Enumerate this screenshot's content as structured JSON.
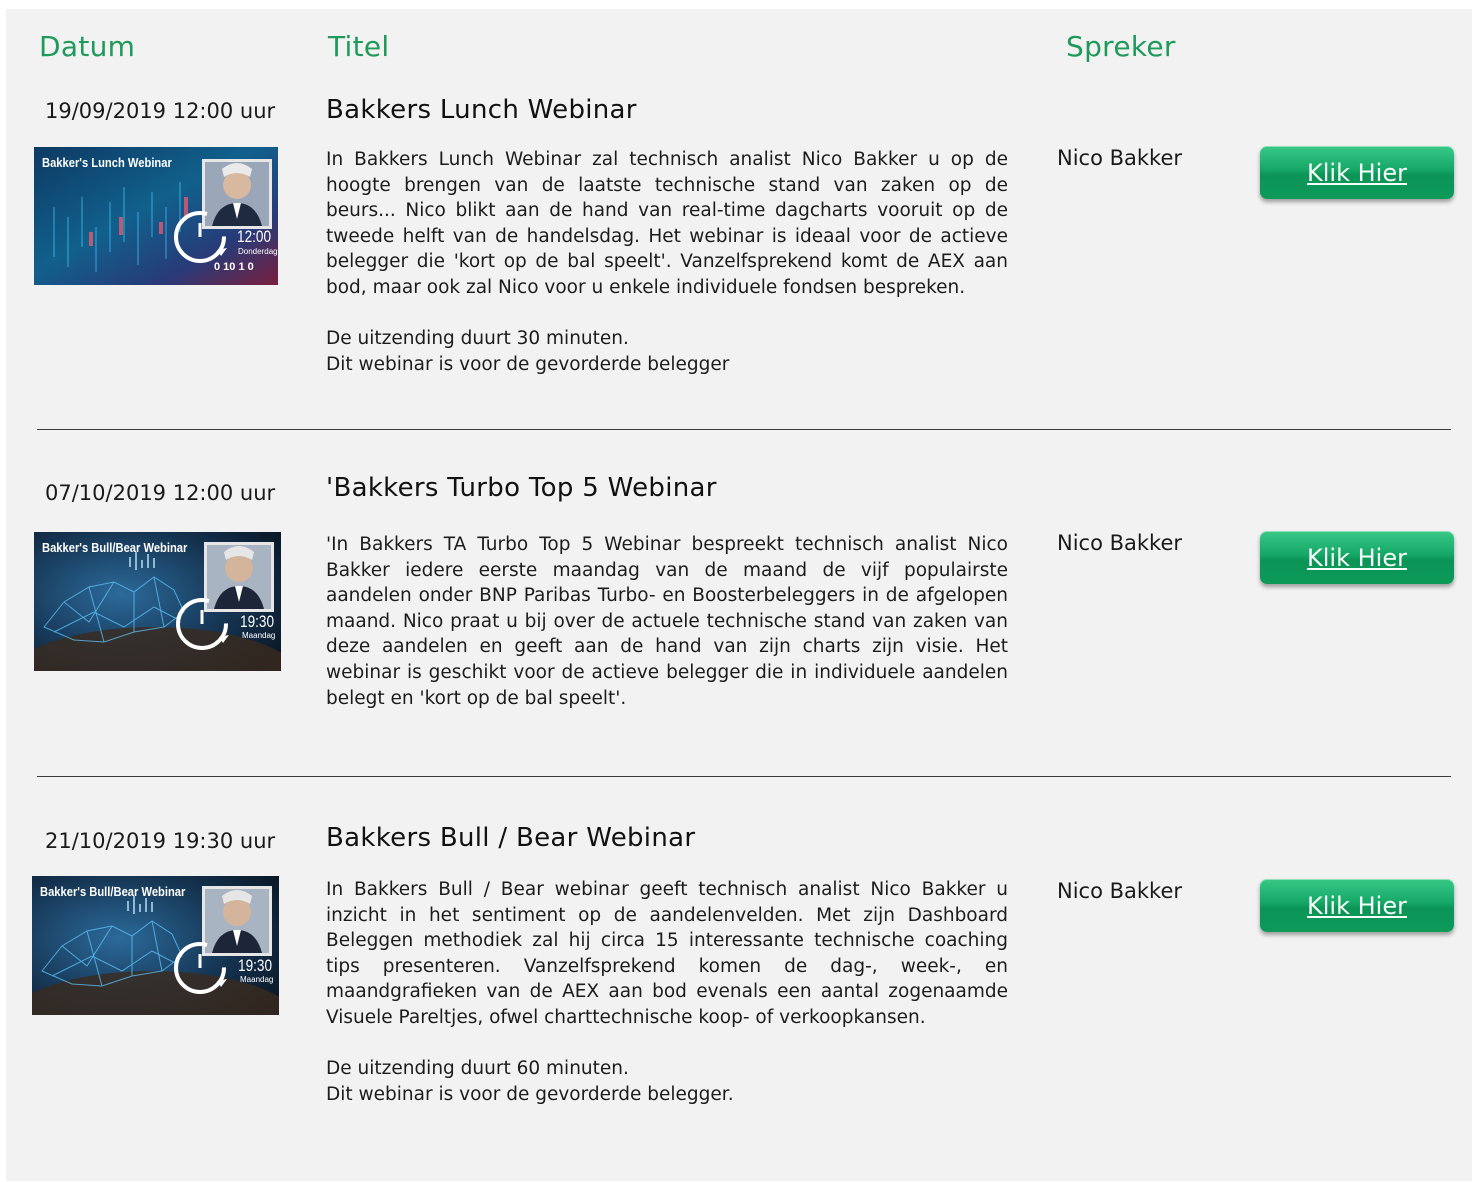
{
  "headers": {
    "datum": "Datum",
    "titel": "Titel",
    "spreker": "Spreker"
  },
  "webinars": [
    {
      "date": "19/09/2019 12:00 uur",
      "title": "Bakkers Lunch Webinar",
      "description": "In Bakkers Lunch Webinar zal technisch analist Nico Bakker u op de hoogte brengen van de laatste technische stand van zaken op de beurs... Nico blikt aan de hand van real-time dagcharts vooruit op de tweede helft van de handelsdag. Het webinar is ideaal voor de actieve belegger die 'kort op de bal speelt'. Vanzelfsprekend komt de AEX aan bod, maar ook zal Nico voor u enkele individuele fondsen bespreken.",
      "duration": "De uitzending duurt 30 minuten.",
      "audience": "Dit webinar is voor de gevorderde belegger",
      "speaker": "Nico Bakker",
      "button": "Klik Hier",
      "thumb": {
        "title": "Bakker's Lunch Webinar",
        "time": "12:00",
        "day": "Donderdag",
        "ticks": "0 10 1 0"
      }
    },
    {
      "date": "07/10/2019 12:00 uur",
      "title": "'Bakkers Turbo Top 5 Webinar",
      "description": "'In Bakkers TA Turbo Top 5 Webinar bespreekt technisch analist Nico Bakker iedere eerste maandag van de maand de vijf populairste aandelen onder BNP Paribas Turbo- en Boosterbeleggers in de afgelopen maand. Nico praat u bij over de actuele technische stand van zaken van deze aandelen en geeft aan de hand van zijn charts zijn visie. Het webinar is geschikt voor de actieve belegger die in individuele aandelen belegt en 'kort op de bal speelt'.",
      "duration": "",
      "audience": "",
      "speaker": "Nico Bakker",
      "button": "Klik Hier",
      "thumb": {
        "title": "Bakker's Bull/Bear Webinar",
        "time": "19:30",
        "day": "Maandag"
      }
    },
    {
      "date": "21/10/2019 19:30 uur",
      "title": "Bakkers Bull / Bear Webinar",
      "description": "In Bakkers Bull / Bear webinar geeft technisch analist Nico Bakker u inzicht in het sentiment op de aandelenvelden. Met zijn Dashboard Beleggen methodiek zal hij circa 15 interessante technische coaching tips presenteren. Vanzelfsprekend komen de dag-, week-, en maandgrafieken van de AEX aan bod evenals een aantal zogenaamde Visuele Pareltjes, ofwel charttechnische koop- of verkoopkansen.",
      "duration": "De uitzending duurt 60 minuten.",
      "audience": "Dit webinar is voor de gevorderde belegger.",
      "speaker": "Nico Bakker",
      "button": "Klik Hier",
      "thumb": {
        "title": "Bakker's Bull/Bear Webinar",
        "time": "19:30",
        "day": "Maandag"
      }
    }
  ],
  "colors": {
    "accent": "#1e9a5a",
    "button": "#0f9d5c",
    "background": "#f2f2f2"
  }
}
